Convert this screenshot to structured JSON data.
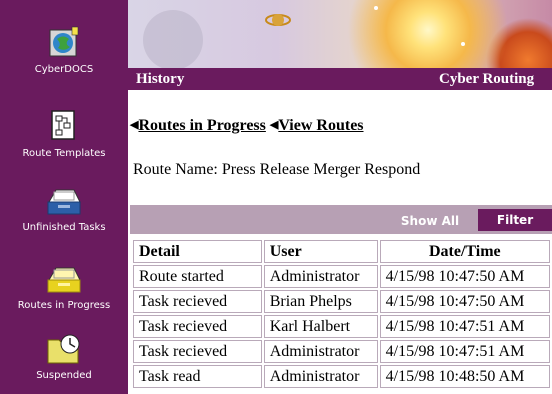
{
  "sidebar": {
    "items": [
      {
        "label": "CyberDOCS",
        "icon": "cyberdocs-globe-icon"
      },
      {
        "label": "Route Templates",
        "icon": "route-templates-icon"
      },
      {
        "label": "Unfinished Tasks",
        "icon": "tray-icon"
      },
      {
        "label": "Routes in Progress",
        "icon": "tray-icon"
      },
      {
        "label": "Suspended",
        "icon": "clock-folder-icon"
      }
    ]
  },
  "header": {
    "left_title": "History",
    "right_title": "Cyber Routing"
  },
  "links": {
    "routes_in_progress": "Routes in Progress",
    "view_routes": "View Routes"
  },
  "route": {
    "name_line": "Route Name: Press Release Merger Respond"
  },
  "toolbar": {
    "show_all": "Show All",
    "filter": "Filter"
  },
  "table": {
    "columns": [
      "Detail",
      "User",
      "Date/Time"
    ],
    "rows": [
      [
        "Route started",
        "Administrator",
        "4/15/98 10:47:50 AM"
      ],
      [
        "Task recieved",
        "Brian Phelps",
        "4/15/98 10:47:50 AM"
      ],
      [
        "Task recieved",
        "Karl Halbert",
        "4/15/98 10:47:51 AM"
      ],
      [
        "Task recieved",
        "Administrator",
        "4/15/98 10:47:51 AM"
      ],
      [
        "Task read",
        "Administrator",
        "4/15/98 10:48:50 AM"
      ]
    ]
  },
  "colors": {
    "sidebar": "#6a1b5e",
    "toolbar": "#b7a0b4"
  }
}
